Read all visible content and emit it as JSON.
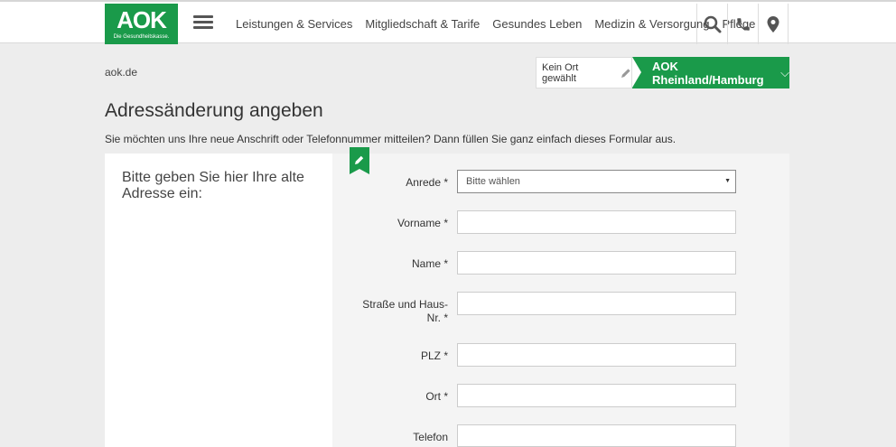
{
  "header": {
    "logo_word": "AOK",
    "logo_tagline": "Die Gesundheitskasse.",
    "nav": [
      "Leistungen & Services",
      "Mitgliedschaft & Tarife",
      "Gesundes Leben",
      "Medizin & Versorgung",
      "Pflege"
    ],
    "icons": [
      "search-icon",
      "phone-icon",
      "location-pin-icon"
    ]
  },
  "breadcrumb": "aok.de",
  "region": {
    "location_label": "Kein Ort gewählt",
    "region_name": "AOK Rheinland/Hamburg",
    "chevron": "⌵"
  },
  "page_title": "Adressänderung angeben",
  "intro": "Sie möchten uns Ihre neue Anschrift oder Telefonnummer mitteilen? Dann füllen Sie ganz einfach dieses Formular aus.",
  "form": {
    "section_title": "Bitte geben Sie hier Ihre alte Adresse ein:",
    "fields": [
      {
        "label": "Anrede  *",
        "value": "Bitte wählen",
        "type": "select"
      },
      {
        "label": "Vorname  *",
        "value": "",
        "type": "text"
      },
      {
        "label": "Name  *",
        "value": "",
        "type": "text"
      },
      {
        "label_line1": "Straße und Haus-",
        "label_line2": "Nr.  *",
        "value": "",
        "type": "text"
      },
      {
        "label": "PLZ  *",
        "value": "",
        "type": "text"
      },
      {
        "label": "Ort  *",
        "value": "",
        "type": "text"
      },
      {
        "label": "Telefon",
        "value": "",
        "type": "text"
      }
    ],
    "colors": {
      "accent": "#1a9a4a",
      "panel": "#f4f4f4",
      "page": "#ededed"
    }
  }
}
